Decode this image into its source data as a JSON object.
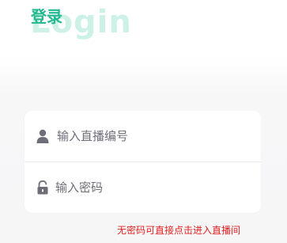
{
  "header": {
    "title": "登录",
    "watermark": "Login"
  },
  "form": {
    "live_number": {
      "placeholder": "输入直播编号",
      "value": "",
      "icon": "user-icon"
    },
    "password": {
      "placeholder": "输入密码",
      "value": "",
      "icon": "lock-icon"
    }
  },
  "hint": {
    "text": "无密码可直接点击进入直播间"
  },
  "colors": {
    "accent": "#23b88f",
    "watermark": "#a6e6d4",
    "hint": "#e22222",
    "icon": "#6e6e78"
  }
}
